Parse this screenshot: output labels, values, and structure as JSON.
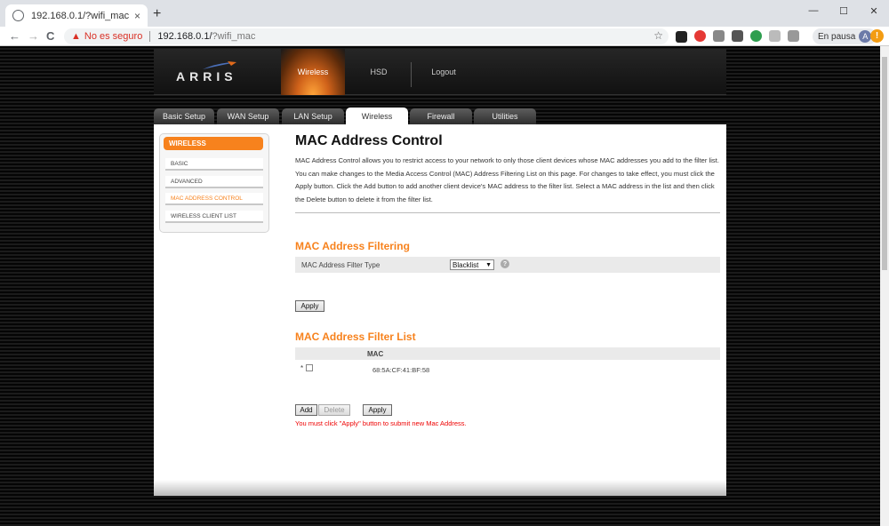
{
  "browser": {
    "tab_title": "192.168.0.1/?wifi_mac",
    "tab_close": "×",
    "new_tab": "+",
    "min": "—",
    "max": "☐",
    "close": "✕",
    "back": "←",
    "forward": "→",
    "reload": "C",
    "warning": "▲",
    "insecure_label": "No es seguro",
    "url_host": "192.168.0.1/",
    "url_path": "?wifi_mac",
    "bookmark": "☆",
    "paused_label": "En pausa",
    "avatar_letter": "A",
    "alert": "!"
  },
  "router": {
    "logo": "ARRIS",
    "header_tabs": [
      "Wireless",
      "HSD",
      "Logout"
    ],
    "sub_tabs": [
      "Basic Setup",
      "WAN Setup",
      "LAN Setup",
      "Wireless",
      "Firewall",
      "Utilities"
    ],
    "active_sub_tab": "Wireless",
    "sidebar": {
      "heading": "WIRELESS",
      "items": [
        "BASIC",
        "ADVANCED",
        "MAC ADDRESS CONTROL",
        "WIRELESS CLIENT LIST"
      ],
      "active": "MAC ADDRESS CONTROL"
    }
  },
  "main": {
    "title": "MAC Address Control",
    "description": "MAC Address Control allows you to restrict access to your network to only those client devices whose MAC addresses you add to the filter list. You can make changes to the Media Access Control (MAC) Address Filtering List on this page. For changes to take effect, you must click the Apply button. Click the Add button to add another client device's MAC address to the filter list. Select a MAC address in the list and then click the Delete button to delete it from the filter list.",
    "filtering": {
      "heading": "MAC Address Filtering",
      "filter_type_label": "MAC Address Filter Type",
      "filter_type_value": "Blacklist",
      "help": "?",
      "apply": "Apply"
    },
    "filter_list": {
      "heading": "MAC Address Filter List",
      "column": "MAC",
      "rows": [
        {
          "marker": "*",
          "mac": "68:5A:CF:41:BF:58"
        }
      ],
      "add": "Add",
      "delete": "Delete",
      "apply": "Apply",
      "note": "You must click \"Apply\" button to submit new Mac Address."
    }
  },
  "colors": {
    "accent": "#f7821d",
    "error": "#e00000"
  }
}
